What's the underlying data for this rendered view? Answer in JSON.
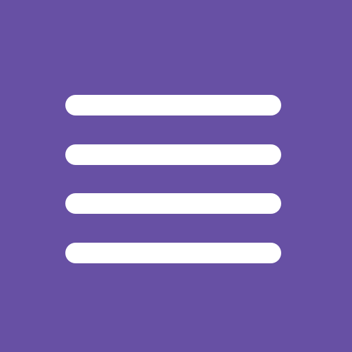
{
  "icon": {
    "name": "menu-icon",
    "background_color": "#6750A4",
    "line_color": "#FFFFFF",
    "line_count": 4
  }
}
